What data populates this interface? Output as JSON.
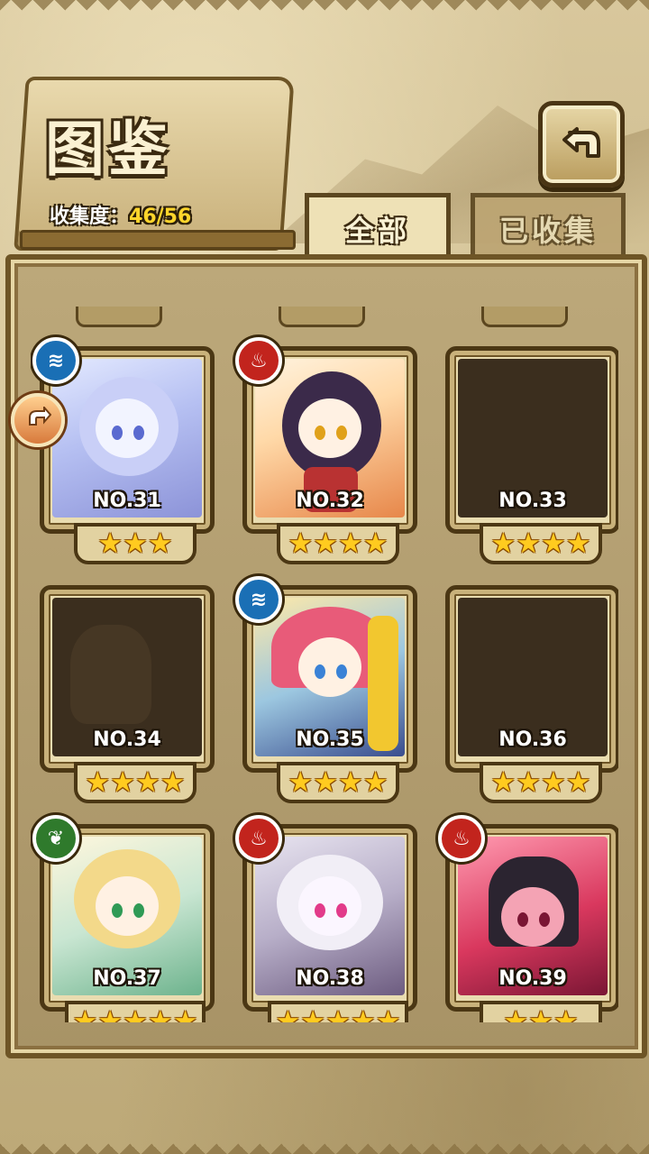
{
  "header": {
    "title": "图鉴",
    "collection_label": "收集度：",
    "collection_value": "46/56"
  },
  "tabs": [
    {
      "label": "全部",
      "active": true
    },
    {
      "label": "已收集",
      "active": false
    }
  ],
  "icons": {
    "back": "back-arrow-icon",
    "side": "rotate-arrow-icon",
    "water": "water-element-icon",
    "fire": "fire-element-icon",
    "wood": "leaf-element-icon"
  },
  "colors": {
    "star": "#ffcb1f",
    "water": "#1a6fb5",
    "fire": "#c2241d",
    "wood": "#2f7a2c",
    "collection_value": "#ffd52b"
  },
  "cards": [
    {
      "no": "NO.31",
      "stars": 3,
      "element": "water",
      "collected": true
    },
    {
      "no": "NO.32",
      "stars": 4,
      "element": "fire",
      "collected": true
    },
    {
      "no": "NO.33",
      "stars": 4,
      "element": "",
      "collected": false
    },
    {
      "no": "NO.34",
      "stars": 4,
      "element": "",
      "collected": false
    },
    {
      "no": "NO.35",
      "stars": 4,
      "element": "water",
      "collected": true
    },
    {
      "no": "NO.36",
      "stars": 4,
      "element": "",
      "collected": false
    },
    {
      "no": "NO.37",
      "stars": 5,
      "element": "wood",
      "collected": true
    },
    {
      "no": "NO.38",
      "stars": 5,
      "element": "fire",
      "collected": true
    },
    {
      "no": "NO.39",
      "stars": 3,
      "element": "fire",
      "collected": true
    }
  ]
}
